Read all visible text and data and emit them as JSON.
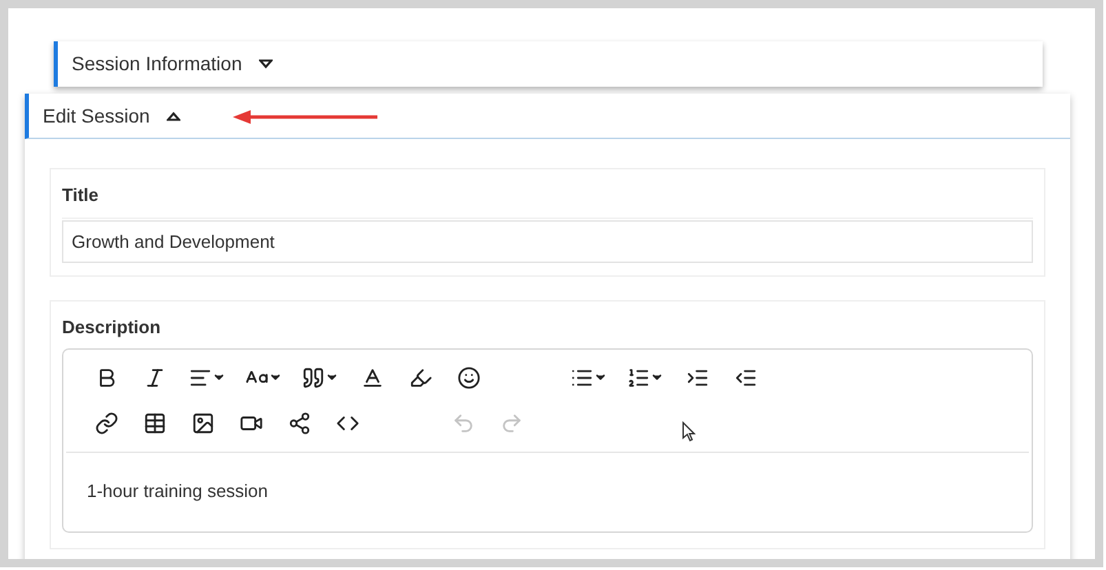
{
  "sections": [
    {
      "title": "Session Information",
      "expanded": false
    },
    {
      "title": "Edit Session",
      "expanded": true
    }
  ],
  "title_field": {
    "label": "Title",
    "value": "Growth and Development"
  },
  "description": {
    "label": "Description",
    "toolbar_rows": [
      [
        {
          "dropdown": false,
          "disabled": false
        },
        {
          "dropdown": false,
          "disabled": false
        },
        {
          "dropdown": true,
          "disabled": false
        },
        {
          "dropdown": true,
          "disabled": false
        },
        {
          "dropdown": true,
          "disabled": false
        },
        {
          "dropdown": false,
          "disabled": false
        },
        {
          "dropdown": false,
          "disabled": false
        },
        {
          "dropdown": false,
          "disabled": false
        },
        {
          "dropdown": true,
          "disabled": false
        },
        {
          "dropdown": true,
          "disabled": false
        },
        {
          "dropdown": false,
          "disabled": false
        },
        {
          "dropdown": false,
          "disabled": false
        }
      ],
      [
        {
          "dropdown": false,
          "disabled": false
        },
        {
          "dropdown": false,
          "disabled": false
        },
        {
          "dropdown": false,
          "disabled": false
        },
        {
          "dropdown": false,
          "disabled": false
        },
        {
          "dropdown": false,
          "disabled": false
        },
        {
          "dropdown": false,
          "disabled": false
        },
        {
          "dropdown": false,
          "disabled": true
        },
        {
          "dropdown": false,
          "disabled": true
        }
      ]
    ],
    "content": "1-hour training session"
  }
}
